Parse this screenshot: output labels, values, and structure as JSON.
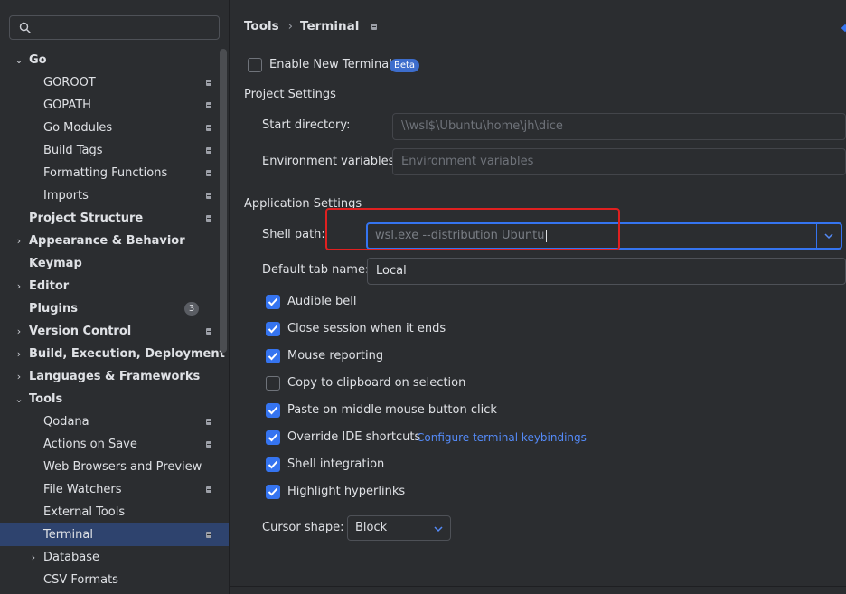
{
  "sidebar": {
    "search_placeholder": "",
    "items": [
      {
        "label": "Go"
      },
      {
        "label": "GOROOT"
      },
      {
        "label": "GOPATH"
      },
      {
        "label": "Go Modules"
      },
      {
        "label": "Build Tags"
      },
      {
        "label": "Formatting Functions"
      },
      {
        "label": "Imports"
      },
      {
        "label": "Project Structure"
      },
      {
        "label": "Appearance & Behavior"
      },
      {
        "label": "Keymap"
      },
      {
        "label": "Editor"
      },
      {
        "label": "Plugins",
        "badge": "3"
      },
      {
        "label": "Version Control"
      },
      {
        "label": "Build, Execution, Deployment"
      },
      {
        "label": "Languages & Frameworks"
      },
      {
        "label": "Tools"
      },
      {
        "label": "Qodana"
      },
      {
        "label": "Actions on Save"
      },
      {
        "label": "Web Browsers and Preview"
      },
      {
        "label": "File Watchers"
      },
      {
        "label": "External Tools"
      },
      {
        "label": "Terminal"
      },
      {
        "label": "Database"
      },
      {
        "label": "CSV Formats"
      }
    ]
  },
  "breadcrumb": {
    "parent": "Tools",
    "separator": "›",
    "current": "Terminal"
  },
  "terminal": {
    "enable_new_terminal_label": "Enable New Terminal",
    "enable_new_terminal_checked": false,
    "beta_badge": "Beta",
    "project_settings_title": "Project Settings",
    "start_directory_label": "Start directory:",
    "start_directory_value": "\\\\wsl$\\Ubuntu\\home\\jh\\dice",
    "env_vars_label": "Environment variables:",
    "env_vars_placeholder": "Environment variables",
    "application_settings_title": "Application Settings",
    "shell_path_label": "Shell path:",
    "shell_path_value": "wsl.exe --distribution Ubuntu",
    "default_tab_name_label": "Default tab name:",
    "default_tab_name_value": "Local",
    "options": [
      {
        "label": "Audible bell",
        "checked": true
      },
      {
        "label": "Close session when it ends",
        "checked": true
      },
      {
        "label": "Mouse reporting",
        "checked": true
      },
      {
        "label": "Copy to clipboard on selection",
        "checked": false
      },
      {
        "label": "Paste on middle mouse button click",
        "checked": true
      },
      {
        "label": "Override IDE shortcuts",
        "checked": true
      },
      {
        "label": "Shell integration",
        "checked": true
      },
      {
        "label": "Highlight hyperlinks",
        "checked": true
      }
    ],
    "configure_keybindings_link": "Configure terminal keybindings",
    "cursor_shape_label": "Cursor shape:",
    "cursor_shape_value": "Block"
  },
  "colors": {
    "background": "#2b2d30",
    "accent": "#3574f0",
    "selection": "#2e436e",
    "annotation_box": "#e02020"
  }
}
